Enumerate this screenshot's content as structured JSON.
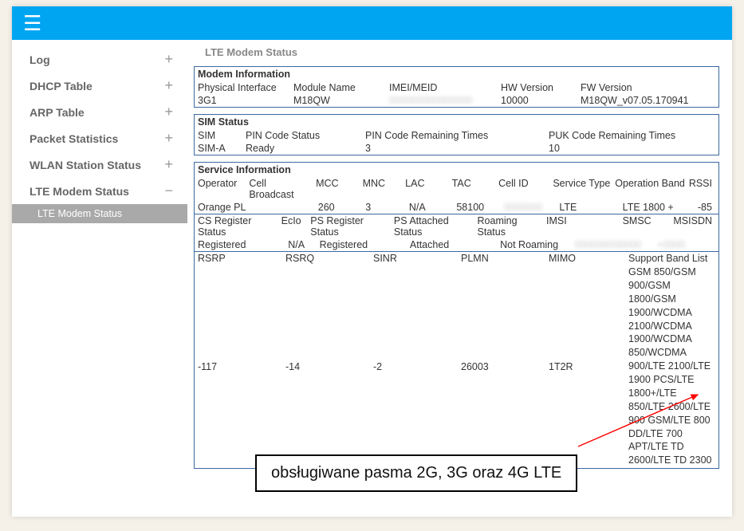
{
  "sidebar": {
    "items": [
      {
        "label": "Log",
        "expanded": false
      },
      {
        "label": "DHCP Table",
        "expanded": false
      },
      {
        "label": "ARP Table",
        "expanded": false
      },
      {
        "label": "Packet Statistics",
        "expanded": false
      },
      {
        "label": "WLAN Station Status",
        "expanded": false
      },
      {
        "label": "LTE Modem Status",
        "expanded": true
      }
    ],
    "subitem": "LTE Modem Status"
  },
  "page_title": "LTE Modem Status",
  "modem_info": {
    "heading": "Modem Information",
    "headers": [
      "Physical Interface",
      "Module Name",
      "IMEI/MEID",
      "HW Version",
      "FW Version"
    ],
    "values": [
      "3G1",
      "M18QW",
      "",
      "10000",
      "M18QW_v07.05.170941"
    ]
  },
  "sim_status": {
    "heading": "SIM Status",
    "headers": [
      "SIM",
      "PIN Code Status",
      "PIN Code Remaining Times",
      "PUK Code Remaining Times"
    ],
    "values": [
      "SIM-A",
      "Ready",
      "3",
      "10"
    ]
  },
  "service_info": {
    "heading": "Service Information",
    "row1_headers": [
      "Operator",
      "Cell Broadcast",
      "MCC",
      "MNC",
      "LAC",
      "TAC",
      "Cell ID",
      "Service Type",
      "Operation Band",
      "RSSI"
    ],
    "row1_values": [
      "Orange PL",
      "",
      "260",
      "3",
      "N/A",
      "58100",
      "",
      "LTE",
      "LTE 1800 +",
      "-85"
    ],
    "row2_headers": [
      "CS Register Status",
      "EcIo",
      "PS Register Status",
      "PS Attached Status",
      "Roaming Status",
      "IMSI",
      "SMSC",
      "MSISDN"
    ],
    "row2_values": [
      "Registered",
      "N/A",
      "Registered",
      "Attached",
      "Not Roaming",
      "",
      "",
      ""
    ],
    "row3_headers": [
      "RSRP",
      "RSRQ",
      "SINR",
      "PLMN",
      "MIMO",
      "Support Band List"
    ],
    "row3_values": [
      "-117",
      "-14",
      "-2",
      "26003",
      "1T2R",
      "GSM 850/GSM 900/GSM 1800/GSM 1900/WCDMA 2100/WCDMA 1900/WCDMA 850/WCDMA 900/LTE 2100/LTE 1900 PCS/LTE 1800+/LTE 850/LTE 2600/LTE 900 GSM/LTE 800 DD/LTE 700 APT/LTE TD 2600/LTE TD 2300"
    ]
  },
  "callout": "obsługiwane pasma 2G, 3G oraz 4G LTE"
}
